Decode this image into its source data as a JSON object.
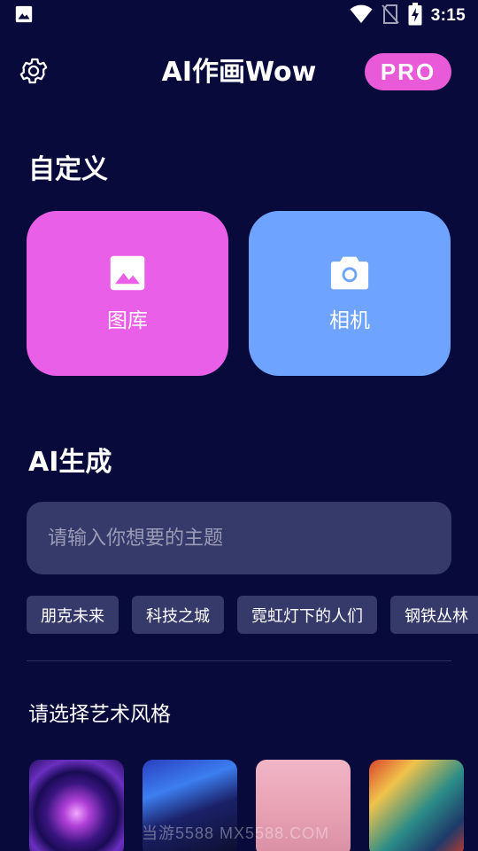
{
  "status_bar": {
    "time": "3:15",
    "icons": [
      "image-notification-icon",
      "wifi-icon",
      "no-sim-icon",
      "battery-charging-icon"
    ]
  },
  "header": {
    "title": "AI作画Wow",
    "pro_label": "PRO",
    "settings_icon": "gear-icon"
  },
  "custom_section": {
    "title": "自定义",
    "gallery": {
      "label": "图库",
      "icon": "image-icon",
      "color": "#ea5fe8"
    },
    "camera": {
      "label": "相机",
      "icon": "camera-icon",
      "color": "#6ea4ff"
    }
  },
  "ai_section": {
    "title": "AI生成",
    "input_placeholder": "请输入你想要的主题",
    "input_value": "",
    "chips": [
      "朋克未来",
      "科技之城",
      "霓虹灯下的人们",
      "钢铁丛林"
    ]
  },
  "style_section": {
    "title": "请选择艺术风格",
    "thumbnails": [
      "style-thumbnail-1",
      "style-thumbnail-2",
      "style-thumbnail-3",
      "style-thumbnail-4"
    ]
  },
  "watermark": "当游5588 MX5588.COM",
  "colors": {
    "background": "#070a3a",
    "accent_pink": "#e85ad8",
    "accent_blue": "#6ea4ff",
    "surface": "#363a6a"
  }
}
